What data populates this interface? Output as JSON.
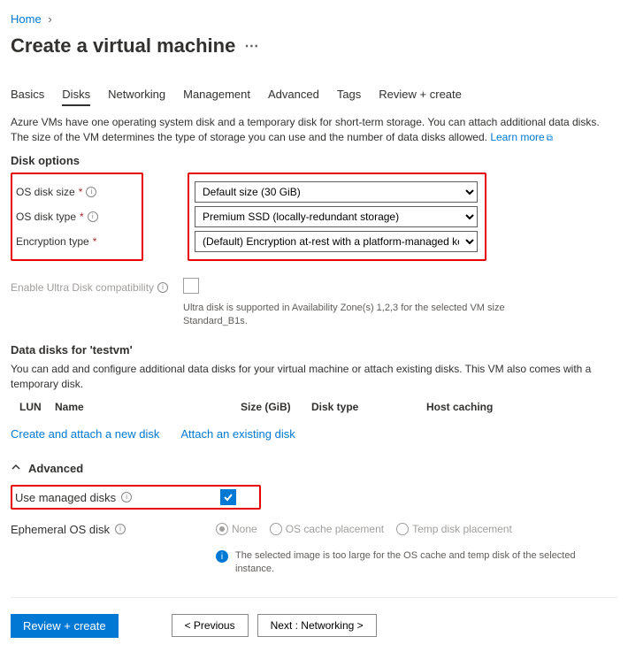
{
  "breadcrumb": {
    "home": "Home"
  },
  "title": "Create a virtual machine",
  "tabs": [
    "Basics",
    "Disks",
    "Networking",
    "Management",
    "Advanced",
    "Tags",
    "Review + create"
  ],
  "active_tab_index": 1,
  "intro": {
    "line": "Azure VMs have one operating system disk and a temporary disk for short-term storage. You can attach additional data disks. The size of the VM determines the type of storage you can use and the number of data disks allowed.",
    "learn": "Learn more"
  },
  "disk_options": {
    "heading": "Disk options",
    "os_size_label": "OS disk size",
    "os_size_value": "Default size (30 GiB)",
    "os_type_label": "OS disk type",
    "os_type_value": "Premium SSD (locally-redundant storage)",
    "enc_label": "Encryption type",
    "enc_value": "(Default) Encryption at-rest with a platform-managed key"
  },
  "ultra": {
    "label": "Enable Ultra Disk compatibility",
    "hint": "Ultra disk is supported in Availability Zone(s) 1,2,3 for the selected VM size Standard_B1s."
  },
  "data_disks": {
    "heading": "Data disks for 'testvm'",
    "desc": "You can add and configure additional data disks for your virtual machine or attach existing disks. This VM also comes with a temporary disk.",
    "cols": {
      "lun": "LUN",
      "name": "Name",
      "size": "Size (GiB)",
      "type": "Disk type",
      "cache": "Host caching"
    },
    "create_link": "Create and attach a new disk",
    "attach_link": "Attach an existing disk"
  },
  "advanced": {
    "heading": "Advanced",
    "managed_label": "Use managed disks",
    "managed_checked": true,
    "ephemeral_label": "Ephemeral OS disk",
    "radios": {
      "none": "None",
      "cache": "OS cache placement",
      "temp": "Temp disk placement"
    },
    "selected_radio": "none",
    "hint": "The selected image is too large for the OS cache and temp disk of the selected instance."
  },
  "footer": {
    "review": "Review + create",
    "prev": "< Previous",
    "next": "Next : Networking >"
  }
}
